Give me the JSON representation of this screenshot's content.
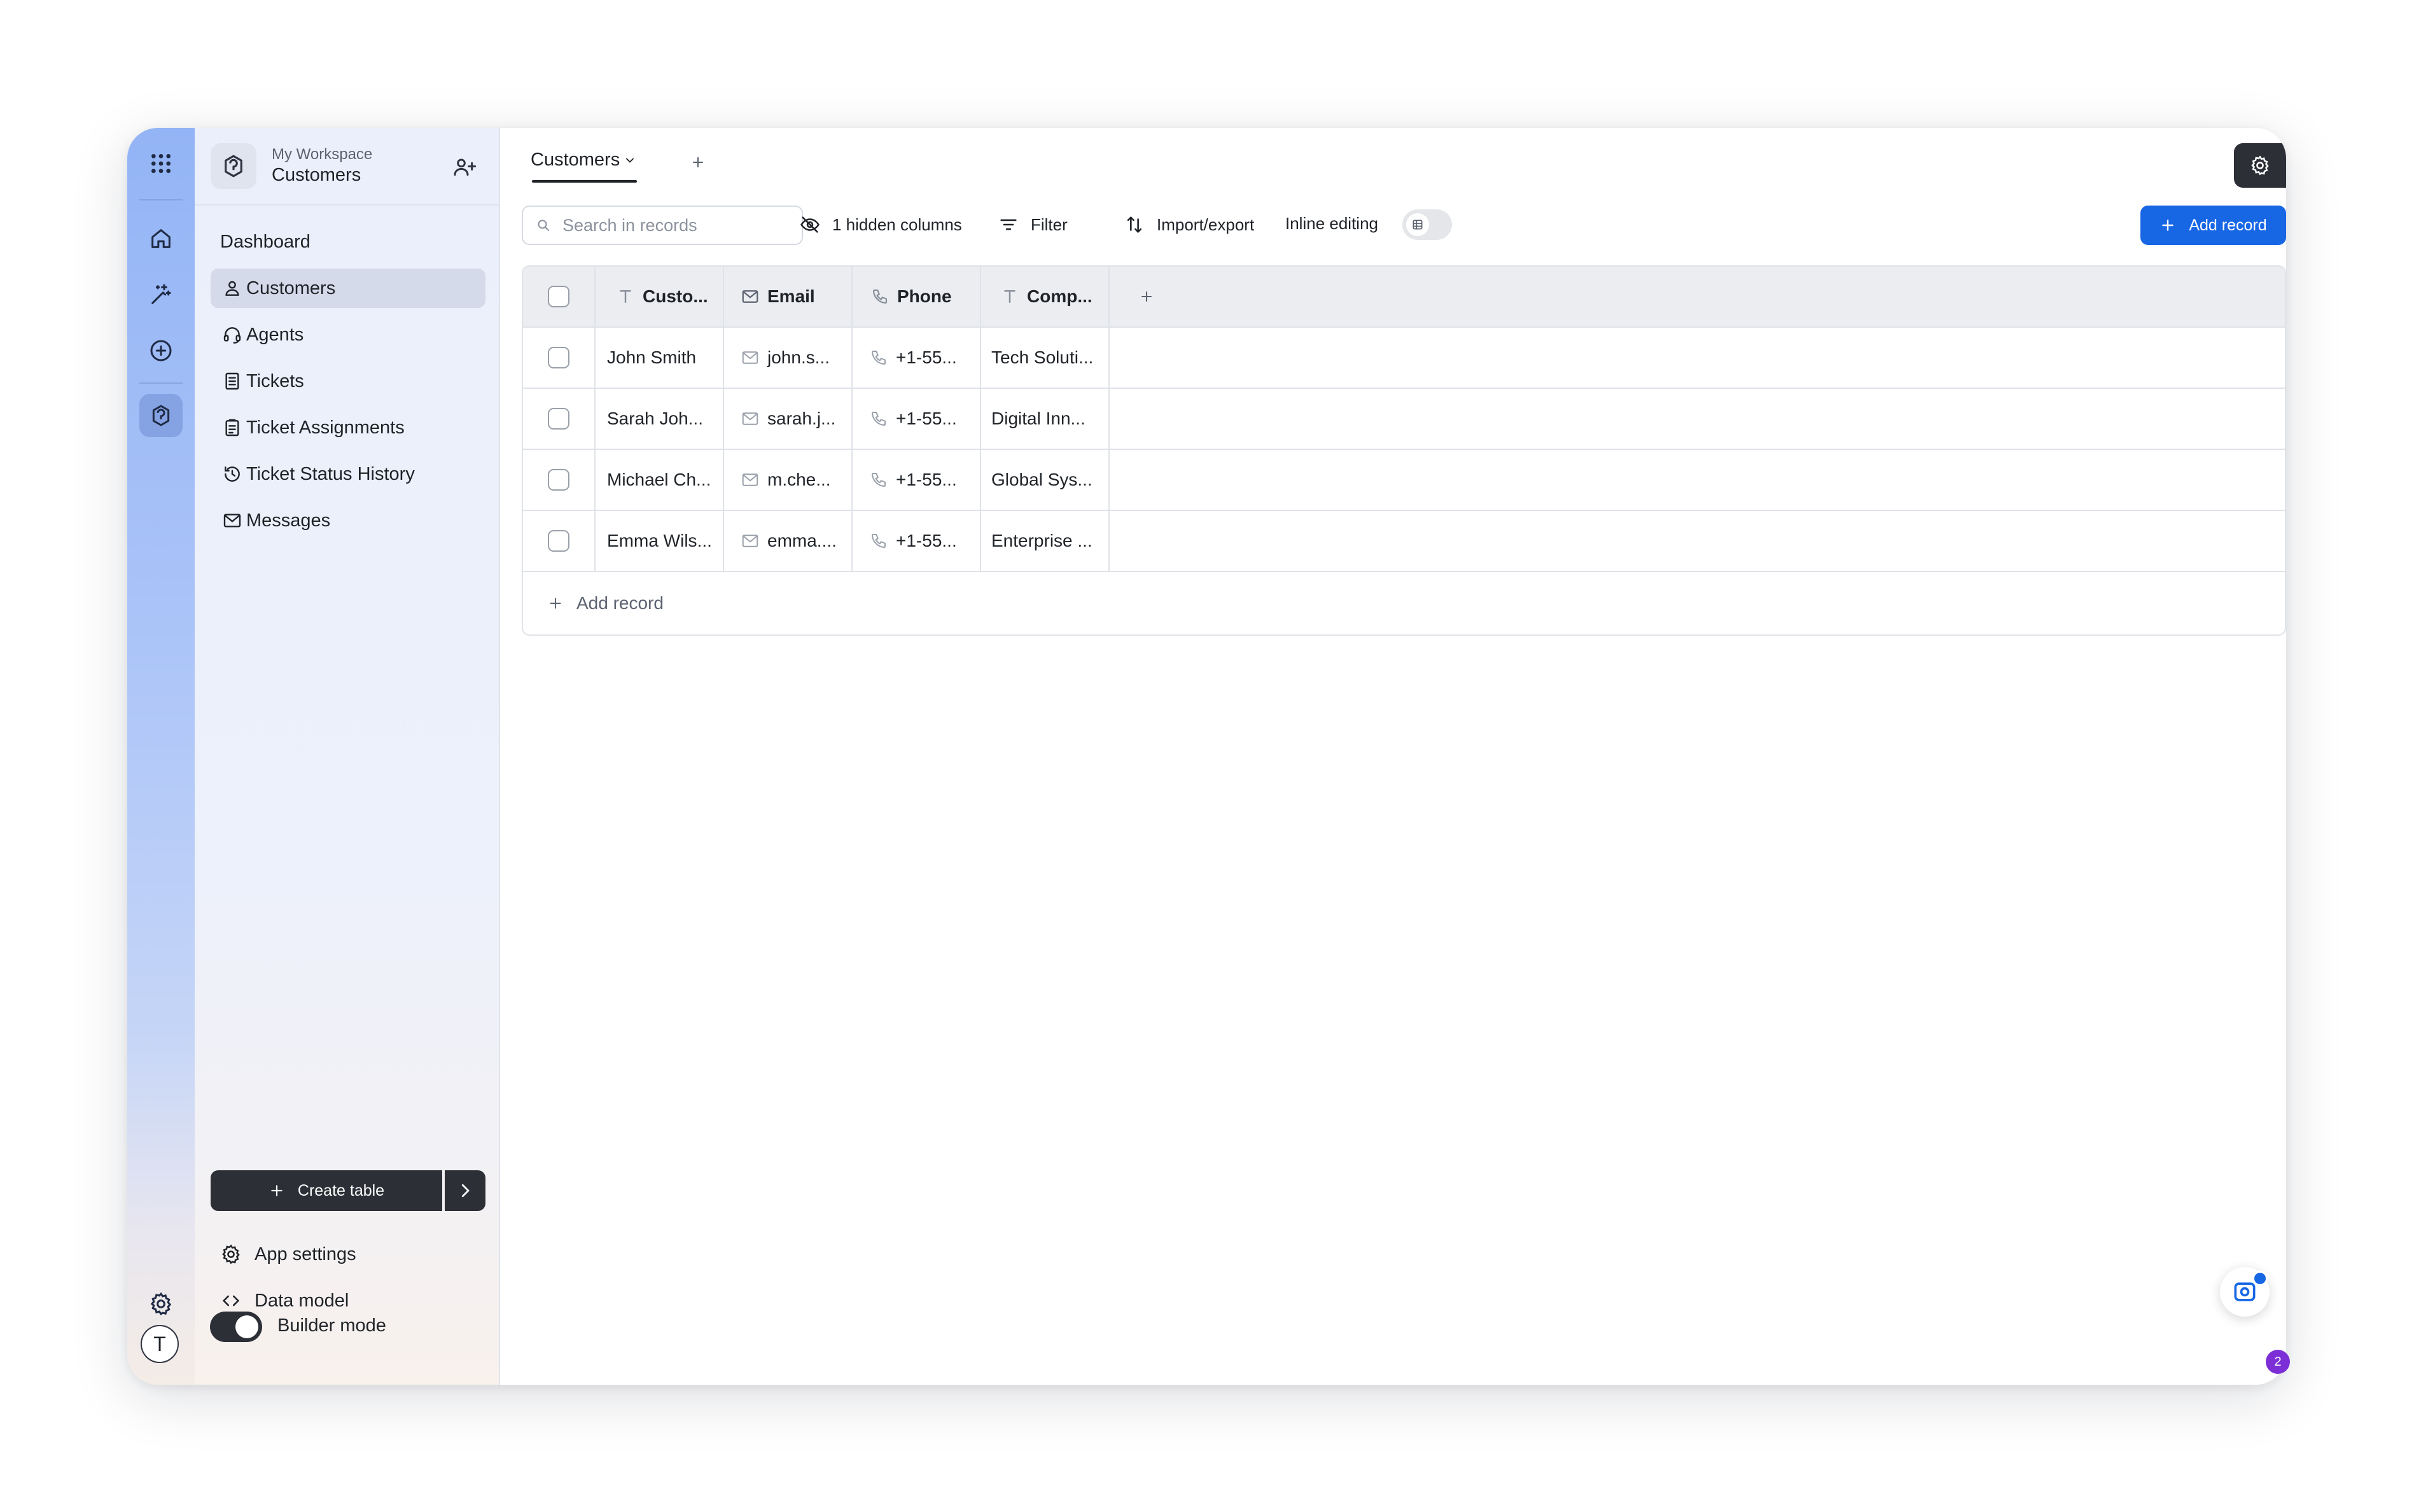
{
  "workspace": {
    "label": "My Workspace",
    "app_name": "Customers"
  },
  "sidebar": {
    "dashboard_label": "Dashboard",
    "items": [
      {
        "label": "Customers",
        "icon": "person-icon",
        "active": true
      },
      {
        "label": "Agents",
        "icon": "headset-icon",
        "active": false
      },
      {
        "label": "Tickets",
        "icon": "document-icon",
        "active": false
      },
      {
        "label": "Ticket Assignments",
        "icon": "clipboard-icon",
        "active": false
      },
      {
        "label": "Ticket Status History",
        "icon": "history-icon",
        "active": false
      },
      {
        "label": "Messages",
        "icon": "mail-icon",
        "active": false
      }
    ],
    "create_table_label": "Create table",
    "app_settings_label": "App settings",
    "data_model_label": "Data model",
    "builder_mode_label": "Builder mode",
    "builder_mode_on": true
  },
  "rail": {
    "avatar_initial": "T"
  },
  "tabs": [
    {
      "label": "Customers",
      "active": true
    }
  ],
  "toolbar": {
    "search_placeholder": "Search in records",
    "hidden_columns_label": "1 hidden columns",
    "filter_label": "Filter",
    "import_export_label": "Import/export",
    "inline_editing_label": "Inline editing",
    "inline_editing_on": false,
    "add_record_label": "Add record"
  },
  "table": {
    "columns": [
      {
        "label": "Custo...",
        "icon": "text-type-icon"
      },
      {
        "label": "Email",
        "icon": "mail-icon"
      },
      {
        "label": "Phone",
        "icon": "phone-icon"
      },
      {
        "label": "Comp...",
        "icon": "text-type-icon"
      }
    ],
    "rows": [
      [
        "John Smith",
        "john.s...",
        "+1-55...",
        "Tech Soluti..."
      ],
      [
        "Sarah Joh...",
        "sarah.j...",
        "+1-55...",
        "Digital Inn..."
      ],
      [
        "Michael Ch...",
        "m.che...",
        "+1-55...",
        "Global Sys..."
      ],
      [
        "Emma Wils...",
        "emma....",
        "+1-55...",
        "Enterprise ..."
      ]
    ],
    "add_record_label": "Add record"
  },
  "notification_badge": "2",
  "colors": {
    "accent": "#1767e5",
    "dark": "#2c2f36",
    "badge": "#7c2fd6"
  }
}
